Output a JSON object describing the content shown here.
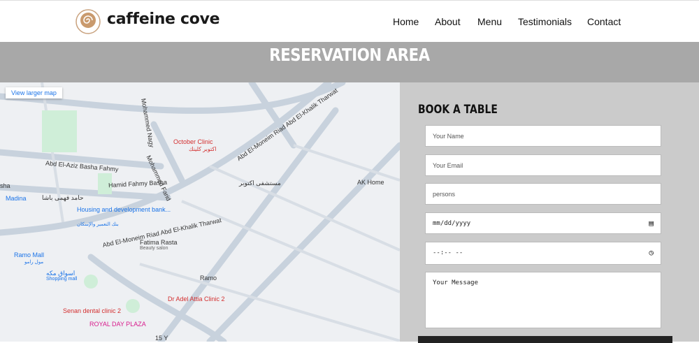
{
  "brand": {
    "name": "caffeine cove"
  },
  "nav": {
    "items": [
      "Home",
      "About",
      "Menu",
      "Testimonials",
      "Contact"
    ]
  },
  "hero": {
    "title": "RESERVATION AREA"
  },
  "map": {
    "view_larger": "View larger map",
    "labels": [
      "Mohammed Nagy",
      "Abd El-Aziz Basha Fahmy",
      "Mohammed Farid",
      "Hamid Fahmy Basha",
      "حامد فهمى باشا",
      "Abd El-Moneim Riad Abd El-Khalik Tharwat",
      "Abd El-Moneim Riad Abd El-Khalik Tharwat",
      "October Clinic",
      "اكتوبر كلينك",
      "مستشفى اكتوبر",
      "AK Home",
      "Madina",
      "Housing and development bank...",
      "بنك التعمير والإسكان",
      "Fatima Rasta",
      "Beauty salon",
      "Ramo Mall",
      "مول رامو",
      "اسواق مكه",
      "Shopping mall",
      "Ramo",
      "Senan dental clinic 2",
      "Dr Adel Attia Clinic 2",
      "ROYAL DAY PLAZA",
      "15 Y",
      "sha"
    ]
  },
  "form": {
    "title": "BOOK A TABLE",
    "name_placeholder": "Your Name",
    "email_placeholder": "Your Email",
    "persons_placeholder": "persons",
    "date_placeholder": "mm/dd/yyyy",
    "time_placeholder": "--:-- --",
    "message_placeholder": "Your Message"
  }
}
